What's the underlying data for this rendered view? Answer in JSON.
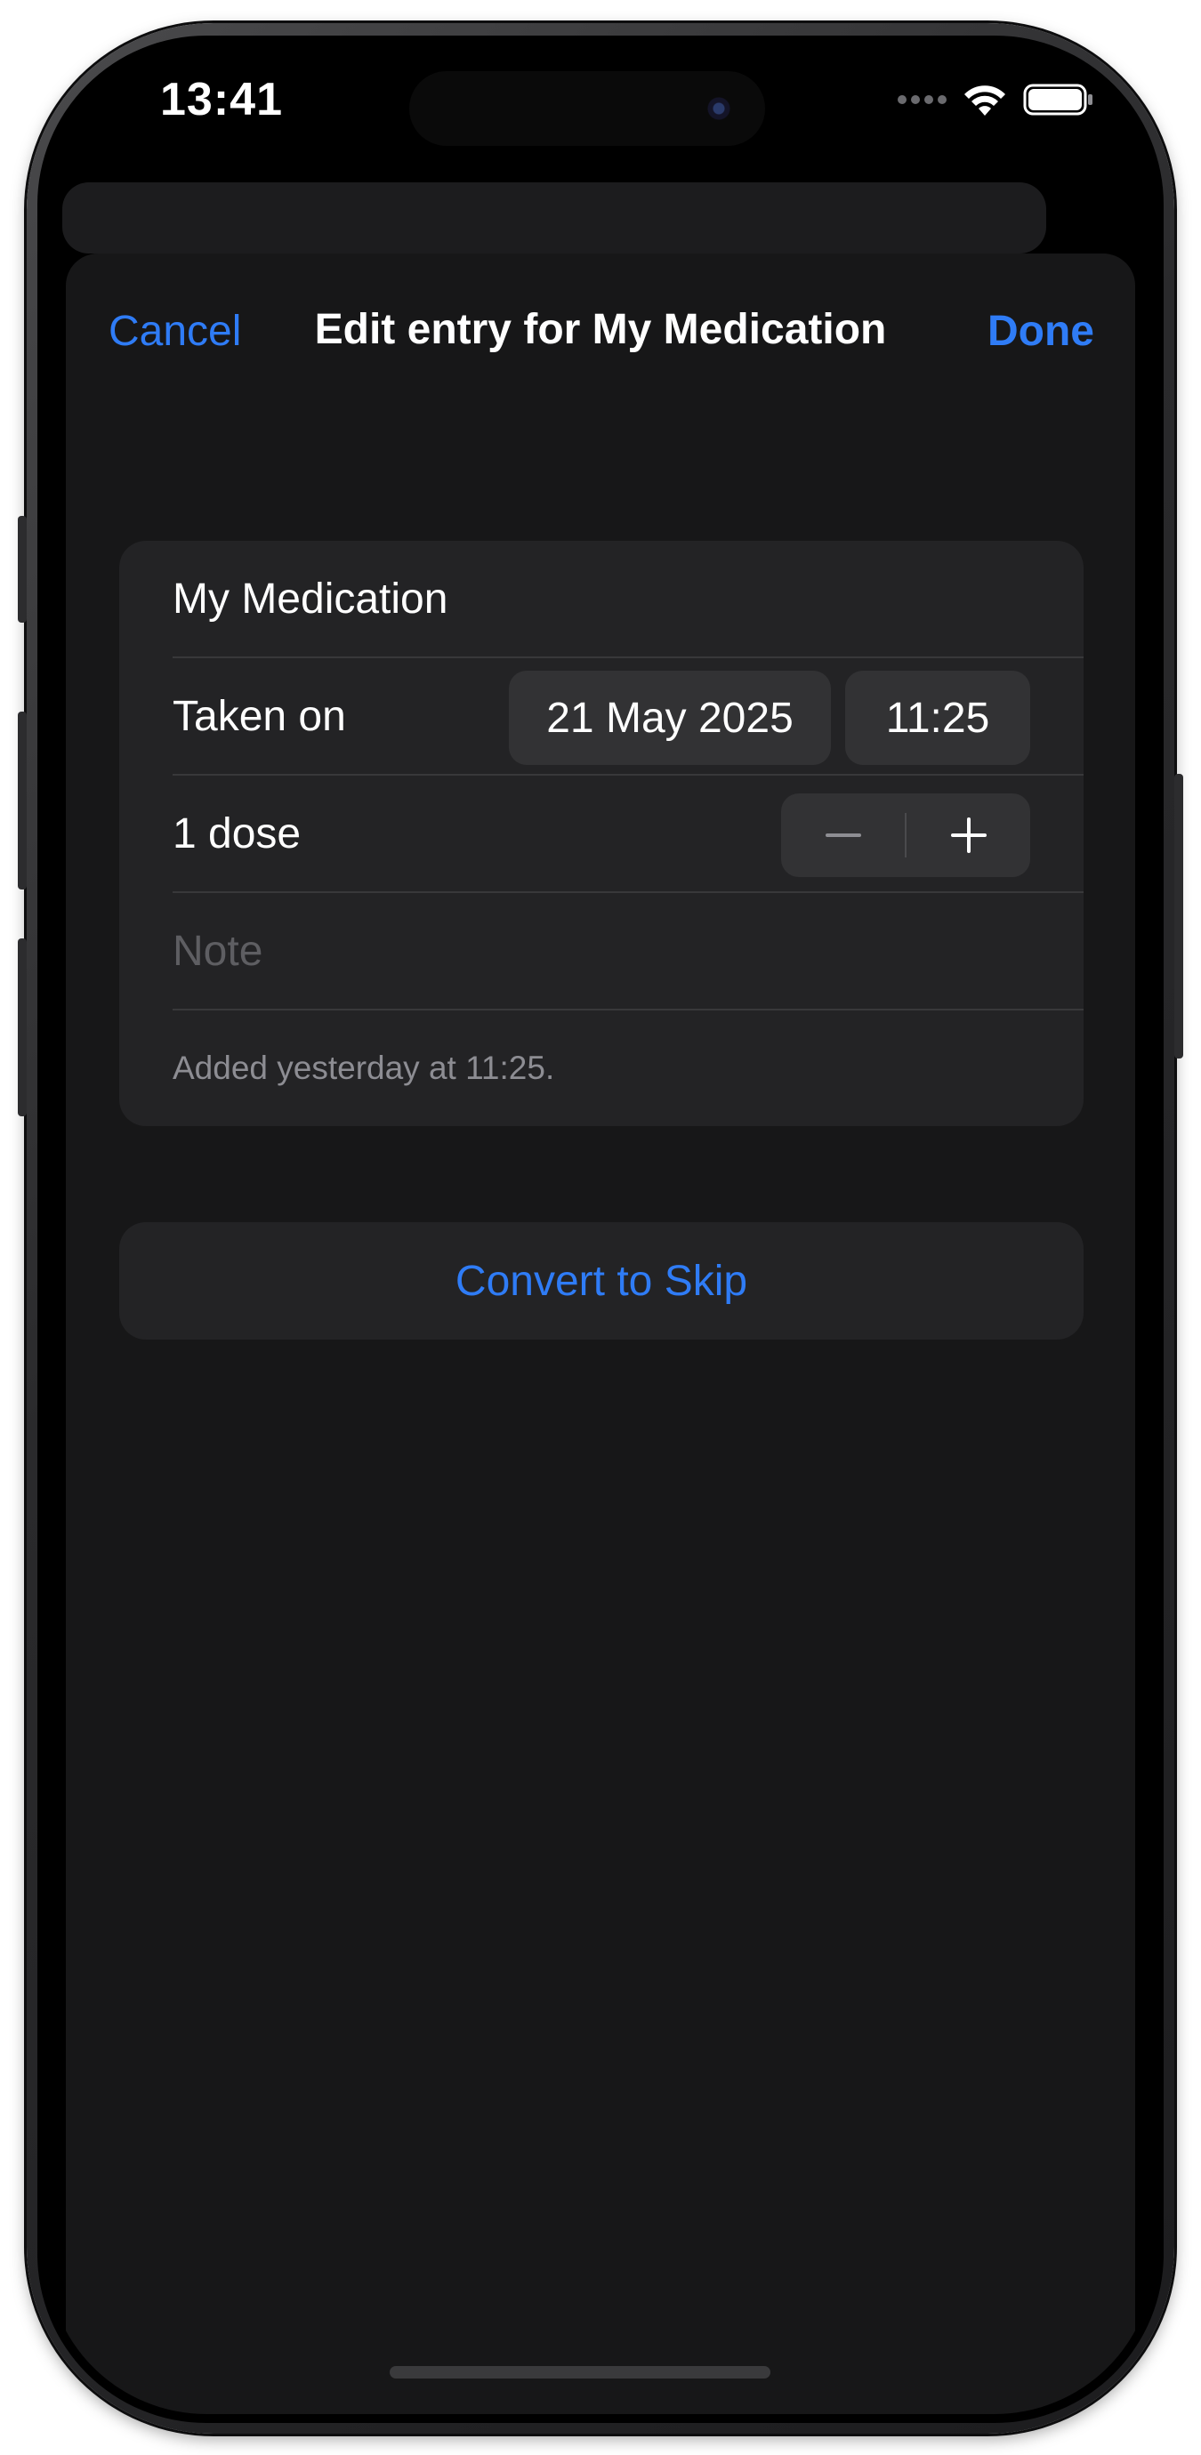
{
  "status_bar": {
    "time": "13:41",
    "icons": [
      "cellular-signal-icon",
      "wifi-icon",
      "battery-icon"
    ]
  },
  "nav": {
    "cancel_label": "Cancel",
    "title": "Edit entry for My Medication",
    "done_label": "Done"
  },
  "entry": {
    "medication_name": "My Medication",
    "taken_on_label": "Taken on",
    "date": "21 May 2025",
    "time": "11:25",
    "dose_label": "1 dose",
    "note_placeholder": "Note",
    "footnote": "Added yesterday at 11:25."
  },
  "actions": {
    "convert_label": "Convert to Skip"
  },
  "colors": {
    "accent": "#2f7cf6",
    "sheet_background": "#171718",
    "group_background": "#232325",
    "control_background": "#323234",
    "secondary_text": "#8d8d93",
    "placeholder_text": "#5e5e62"
  }
}
